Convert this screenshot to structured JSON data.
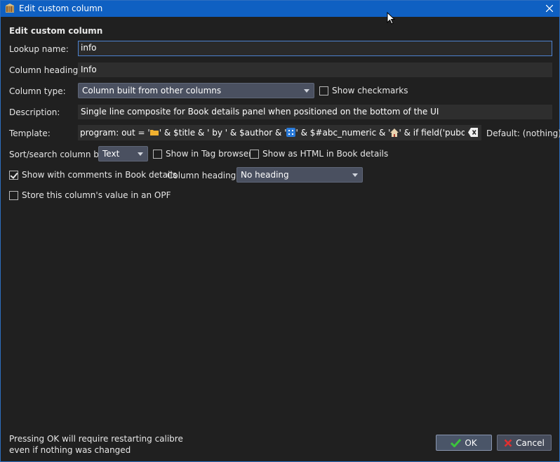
{
  "window": {
    "title": "Edit custom column"
  },
  "heading": "Edit custom column",
  "lookup": {
    "label": "Lookup name:",
    "value": "info"
  },
  "column_heading": {
    "label": "Column heading:",
    "value": "Info"
  },
  "column_type": {
    "label": "Column type:",
    "value": "Column built from other columns",
    "checkmarks_label": "Show checkmarks"
  },
  "description": {
    "label": "Description:",
    "value": "Single line composite for Book details panel when positioned on the bottom of the UI"
  },
  "template": {
    "label": "Template:",
    "part1": "program:         out = '",
    "part2": "' & $title & ' by ' & $author &  '",
    "part3": "' & $#abc_numeric & '",
    "part4": "'  & if field('pubdate') then",
    "default_label": "Default: (nothing)"
  },
  "sort": {
    "label": "Sort/search column by",
    "value": "Text",
    "tag_browser_label": "Show in Tag browser",
    "html_label": "Show as HTML in Book details"
  },
  "comments": {
    "label": "Show with comments in Book details",
    "heading_label": "Column heading:",
    "heading_value": "No heading"
  },
  "opf": {
    "label": "Store this column's value in an OPF"
  },
  "footer": {
    "note_line1": "Pressing OK will require restarting calibre",
    "note_line2": "even if nothing was changed",
    "ok": "OK",
    "cancel": "Cancel"
  },
  "colors": {
    "titlebar": "#0f60c2",
    "background": "#202020",
    "accent": "#4d82d0"
  }
}
